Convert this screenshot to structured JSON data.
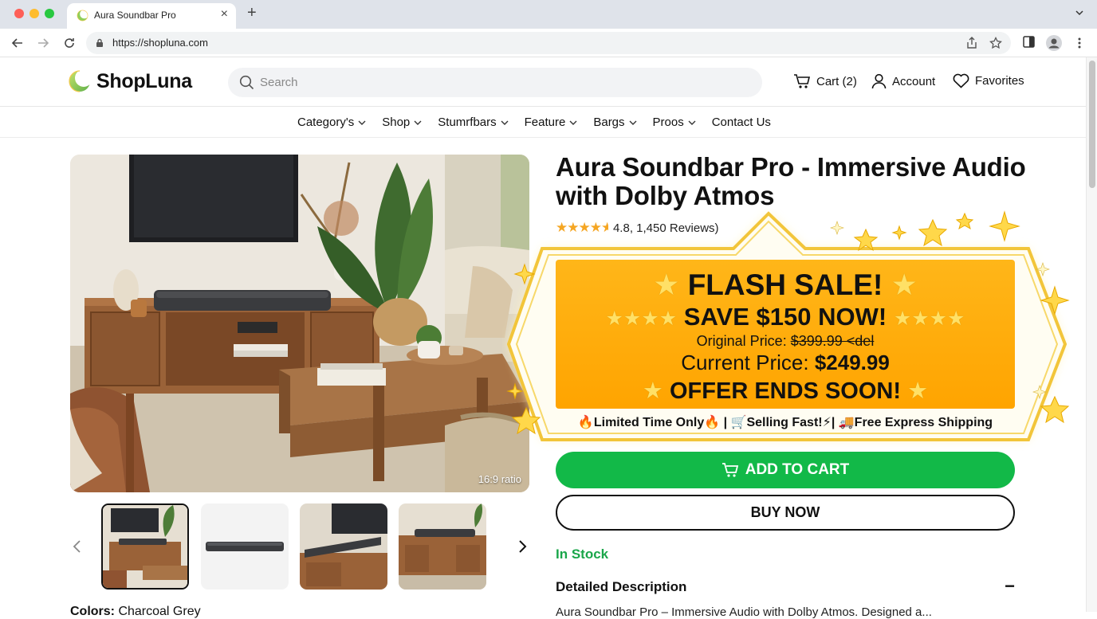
{
  "browser": {
    "tab_title": "Aura Soundbar Pro",
    "url": "https://shopluna.com"
  },
  "header": {
    "logo_text": "ShopLuna",
    "search_placeholder": "Search",
    "cart_label": "Cart (2)",
    "account_label": "Account",
    "favorites_label": "Favorites"
  },
  "nav": {
    "items": [
      "Category's",
      "Shop",
      "Stumrfbars",
      "Feature",
      "Bargs",
      "Proos"
    ],
    "contact": "Contact Us"
  },
  "gallery": {
    "ratio_label": "16:9 ratio",
    "thumbnail_count": 4,
    "active_thumbnail": 1
  },
  "product": {
    "title": "Aura Soundbar Pro - Immersive Audio with Dolby Atmos",
    "rating_value": 4.8,
    "rating_text": "4.8, 1,450 Reviews)",
    "color_label": "Colors:",
    "color_value": "Charcoal Grey",
    "stock_status": "In Stock",
    "description_heading": "Detailed Description",
    "description_toggle": "−",
    "description_text": "Aura Soundbar Pro – Immersive Audio with Dolby Atmos. Designed a..."
  },
  "sale": {
    "headline": "FLASH SALE!",
    "save_text": "SAVE $150 NOW!",
    "original_label": "Original Price:",
    "original_price": "$399.99 <del",
    "current_label": "Current Price:",
    "current_price": "$249.99",
    "offer_text": "OFFER ENDS SOON!",
    "badge_1": "Limited Time Only",
    "badge_2": "Selling Fast!",
    "badge_3": "Free Express Shipping"
  },
  "actions": {
    "add_to_cart": "ADD TO CART",
    "buy_now": "BUY NOW"
  },
  "colors": {
    "sale_bg": "#ffa800",
    "cart_green": "#12b948",
    "stock_green": "#1aa64a",
    "star_gold": "#f5a623"
  }
}
